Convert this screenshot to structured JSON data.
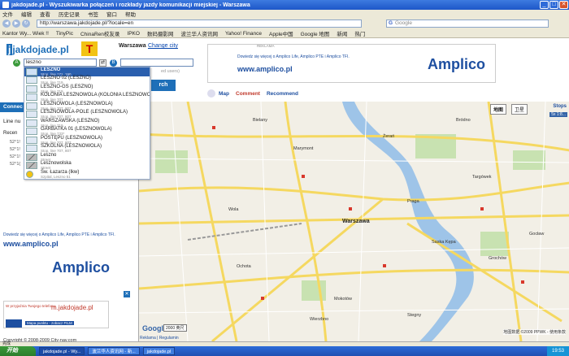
{
  "window": {
    "title": "jakdojade.pl - Wyszukiwarka połączeń i rozkłady jazdy komunikacji miejskiej - Warszawa"
  },
  "menubar": [
    "文件",
    "编辑",
    "查看",
    "历史记录",
    "书签",
    "窗口",
    "帮助"
  ],
  "nav": {
    "url": "http://warszawa.jakdojade.pl/?locale=en",
    "search_placeholder": "Google"
  },
  "bookmarks": [
    "Kantor Wy... Wiek !!",
    "TinyPic",
    "ChinaRen校友录",
    "IPKO",
    "数码摄影网",
    "波兰华人资讯网",
    "Yahoo! Finance",
    "Apple中国",
    "Google 地图",
    "新闻",
    "热门"
  ],
  "header": {
    "logo_text": "jakdojade.pl",
    "city": "Warszawa",
    "change_city": "Change city",
    "from_badge": "A",
    "from_value": "leszno",
    "to_badge": "B",
    "logged_note": "ed users)",
    "search_button": "rch"
  },
  "ad_top": {
    "label": "REKLAMA",
    "text": "Dowiedz się więcej o Amplico Life, Amplico PTE i Amplico TFI.",
    "url": "www.amplico.pl",
    "brand": "Amplico"
  },
  "tabs": [
    "Map",
    "Comment",
    "Recommend"
  ],
  "left": {
    "connections_header": "Connec",
    "line_number": "Line nu",
    "recent": "Recen",
    "recent_items": [
      "52°1!",
      "52°1!",
      "52°1!",
      "52°1("
    ]
  },
  "suggestions": [
    {
      "name": "LESZNO",
      "sub": "Stop, line 171, 190",
      "type": "stop",
      "highlight": true
    },
    {
      "name": "LESZNO 02 (LESZNO)",
      "sub": "Stop, line 719",
      "type": "stop"
    },
    {
      "name": "LESZNO-GS (LESZNO)",
      "sub": "Stop, line 719",
      "type": "stop"
    },
    {
      "name": "KOLONIA LESZNOWOLA (KOLONIA LESZNOWOLA)",
      "sub": "Stop, line 707",
      "type": "stop"
    },
    {
      "name": "LESZNOWOLA (LESZNOWOLA)",
      "sub": "Stop, line 707, 807",
      "type": "stop"
    },
    {
      "name": "LESZNOWOLA-POLE (LESZNOWOLA)",
      "sub": "Stop, line 707, 807",
      "type": "stop"
    },
    {
      "name": "WARSZAWSKA (LESZNO)",
      "sub": "Stop, line 719",
      "type": "stop"
    },
    {
      "name": "GARBATKA 01 (LESZNOWOLA)",
      "sub": "Stop, line 733*",
      "type": "stop"
    },
    {
      "name": "POSTĘPU (LESZNOWOLA)",
      "sub": "Stop, line 707, 807",
      "type": "stop"
    },
    {
      "name": "SZKOLNA (LESZNOWOLA)",
      "sub": "Stop, line 707, 807",
      "type": "stop"
    },
    {
      "name": "Leszno",
      "sub": "Street",
      "type": "street"
    },
    {
      "name": "Lesznowolska",
      "sub": "Street",
      "type": "street"
    },
    {
      "name": "Św. Łazarza (Ikw)",
      "sub": "Szpital, Leszno 51",
      "type": "poi"
    }
  ],
  "ad_left": {
    "text": "Dowiedz się więcej o Amplico Life, Amplico PTE i Amplico TFI.",
    "url": "www.amplico.pl",
    "brand": "Amplico"
  },
  "phone_promo": {
    "line1": "W przyjaźnia Twojego telefonu",
    "line2": "m.jakdojade.pl",
    "line3": "Mapa punktu - zobacz FILM"
  },
  "footer": "Copyright © 2008-2009 City-nav.com",
  "map": {
    "type_map": "地图",
    "type_sat": "卫星",
    "stops_button": "Stops",
    "scale_readout": "5x 1:8...",
    "city_name": "Warszawa",
    "labels": [
      "Żerań",
      "Bródno",
      "Targówek",
      "Praga",
      "Grochów",
      "Wola",
      "Ochota",
      "Mokotów",
      "Wierzbno",
      "Bielany",
      "Marymont",
      "Stegny",
      "Saska Kępa",
      "Gocław"
    ],
    "scale_text": "2000 英尺",
    "attribution": "地图数据 ©2009 PPWK - 使用条款",
    "footer_links": [
      "Reklama",
      "Regulamin"
    ]
  },
  "status": "完成",
  "taskbar": {
    "start": "开始",
    "tasks": [
      "jakdojade.pl - Wy...",
      "波兰华人资讯网 - 新...",
      "jakdojade.pl"
    ],
    "clock": "19:53"
  }
}
